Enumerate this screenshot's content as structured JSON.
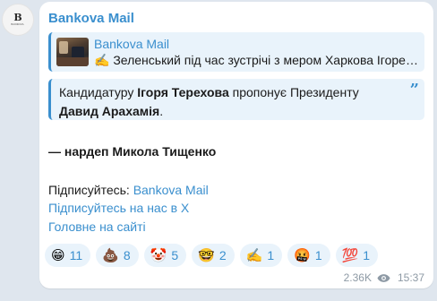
{
  "channel": {
    "avatar_glyph": "B",
    "avatar_wordmark": "BANKOVA",
    "sender_name": "Bankova Mail"
  },
  "reply": {
    "title": "Bankova Mail",
    "text": "✍️ Зеленський під час зустрічі з мером Харкова Ігоре…"
  },
  "quote": {
    "part1": "Кандидатуру ",
    "bold1": "Ігоря Терехова",
    "part2": " пропонує Президенту ",
    "bold2": "Давид Арахамія",
    "part3": ".",
    "quote_mark": "”"
  },
  "body": {
    "author_line": "— нардеп Микола Тищенко",
    "subscribe_prefix": "Підписуйтесь: ",
    "subscribe_link": "Bankova Mail",
    "x_link": "Підписуйтесь на нас в Х",
    "site_link": "Головне на сайті"
  },
  "reactions": [
    {
      "emoji": "😁",
      "icon": "grin-emoji",
      "count": "11"
    },
    {
      "emoji": "💩",
      "icon": "poop-emoji",
      "count": "8"
    },
    {
      "emoji": "🤡",
      "icon": "clown-emoji",
      "count": "5"
    },
    {
      "emoji": "🤓",
      "icon": "nerd-emoji",
      "count": "2"
    },
    {
      "emoji": "✍️",
      "icon": "writing-hand-emoji",
      "count": "1"
    },
    {
      "emoji": "🤬",
      "icon": "cursing-face-emoji",
      "count": "1"
    },
    {
      "emoji": "💯",
      "icon": "hundred-points-emoji",
      "count": "1"
    }
  ],
  "meta": {
    "views": "2.36K",
    "time": "15:37"
  },
  "colors": {
    "accent": "#3a8fce",
    "quote_bg": "#e9f3fb",
    "chat_bg": "#dfe6ee"
  }
}
